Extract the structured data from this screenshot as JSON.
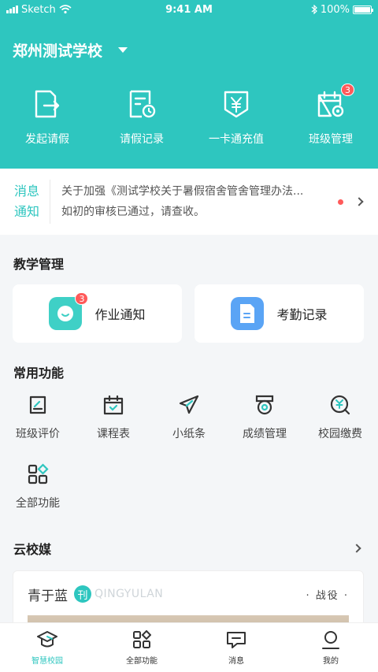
{
  "status": {
    "carrier": "Sketch",
    "time": "9:41 AM",
    "battery": "100%"
  },
  "header": {
    "school": "郑州测试学校"
  },
  "quick_actions": [
    {
      "label": "发起请假",
      "icon": "leave-request-icon"
    },
    {
      "label": "请假记录",
      "icon": "leave-record-icon"
    },
    {
      "label": "一卡通充值",
      "icon": "card-recharge-icon"
    },
    {
      "label": "班级管理",
      "icon": "class-manage-icon",
      "badge": "3"
    }
  ],
  "notice": {
    "tag_line1": "消息",
    "tag_line2": "通知",
    "line1": "关于加强《测试学校关于暑假宿舍管舍管理办法...",
    "line2": "如初的审核已通过，请查收。"
  },
  "teaching": {
    "title": "教学管理",
    "cards": [
      {
        "label": "作业通知",
        "badge": "3",
        "icon": "homework-icon",
        "color": "#3fd0c6"
      },
      {
        "label": "考勤记录",
        "icon": "attendance-icon",
        "color": "#5aa4f5"
      }
    ]
  },
  "common": {
    "title": "常用功能",
    "items": [
      {
        "label": "班级评价",
        "icon": "class-evaluation-icon"
      },
      {
        "label": "课程表",
        "icon": "schedule-icon"
      },
      {
        "label": "小纸条",
        "icon": "paper-plane-icon"
      },
      {
        "label": "成绩管理",
        "icon": "grades-icon"
      },
      {
        "label": "校园缴费",
        "icon": "payment-icon"
      },
      {
        "label": "全部功能",
        "icon": "all-functions-icon"
      }
    ]
  },
  "media": {
    "title": "云校媒",
    "card_name": "青于蓝",
    "logo_char": "刊",
    "card_en": "QINGYULAN",
    "card_tag": "· 战役 ·"
  },
  "tabs": [
    {
      "label": "智慧校园",
      "icon": "campus-icon",
      "active": true
    },
    {
      "label": "全部功能",
      "icon": "grid-icon"
    },
    {
      "label": "消息",
      "icon": "message-icon"
    },
    {
      "label": "我的",
      "icon": "profile-icon"
    }
  ],
  "colors": {
    "accent": "#2ec6bf",
    "badge": "#ff5a5a"
  }
}
